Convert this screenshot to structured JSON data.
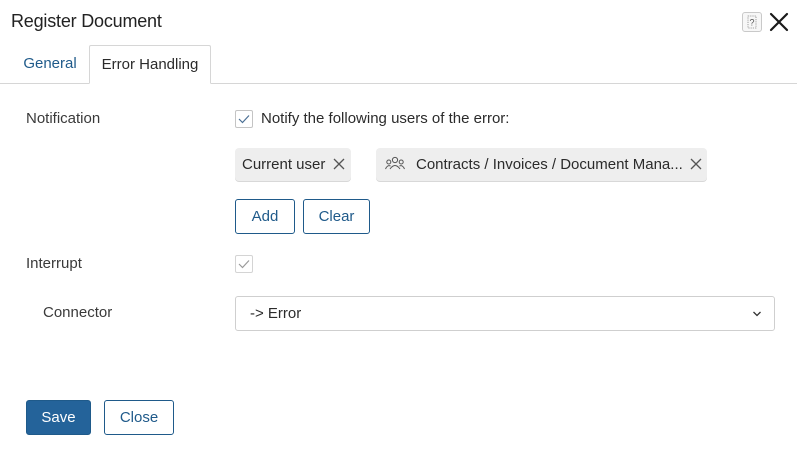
{
  "dialog": {
    "title": "Register Document"
  },
  "tabs": [
    {
      "label": "General",
      "active": false
    },
    {
      "label": "Error Handling",
      "active": true
    }
  ],
  "notification": {
    "label": "Notify the following users of the error:",
    "section_label": "Notification",
    "checked": true,
    "recipients": [
      {
        "label": "Current user",
        "icon": "user"
      },
      {
        "label": "Contracts / Invoices / Document Mana...",
        "icon": "group-icon"
      }
    ],
    "add_label": "Add",
    "clear_label": "Clear"
  },
  "interrupt": {
    "label": "Interrupt",
    "checked": true
  },
  "connector": {
    "label": "Connector",
    "value": "-> Error"
  },
  "footer": {
    "save_label": "Save",
    "close_label": "Close"
  },
  "colors": {
    "accent": "#1f5a8a",
    "primary_button": "#24639a",
    "tag_background": "#eeeeee"
  }
}
